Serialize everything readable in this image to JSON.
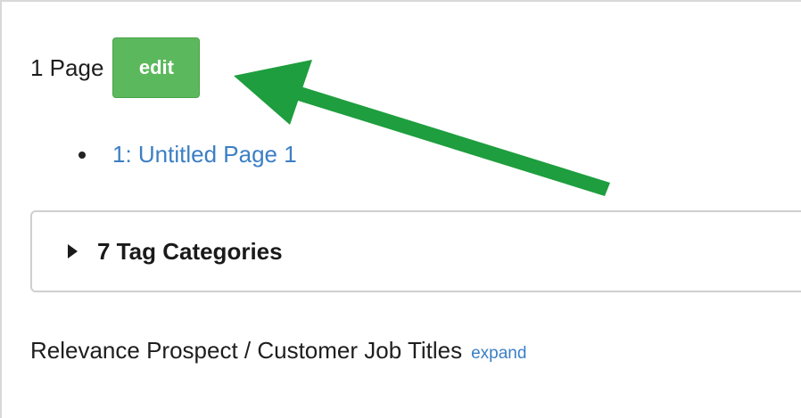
{
  "pages": {
    "count_label": "1 Page",
    "edit_label": "edit",
    "items": [
      {
        "label": "1: Untitled Page 1"
      }
    ]
  },
  "tag_categories": {
    "title": "7 Tag Categories",
    "expanded": false
  },
  "relevance": {
    "label": "Relevance Prospect / Customer Job Titles",
    "expand_label": "expand"
  },
  "annotation": {
    "arrow_color": "#1e9e3e",
    "points_to": "edit-button"
  },
  "colors": {
    "edit_button": "#5cb85c",
    "link": "#3b7fc4"
  }
}
